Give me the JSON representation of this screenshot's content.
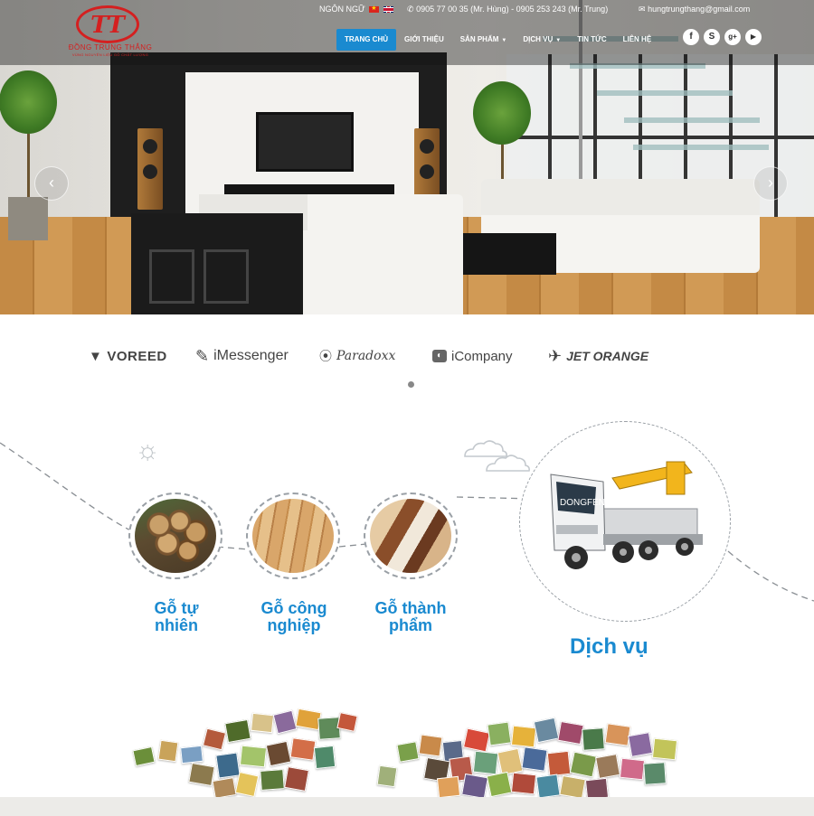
{
  "header": {
    "logo_text": "ĐỒNG TRUNG THẮNG",
    "logo_sub": "VÙNG NGUYÊN LIỆU GỖ CHẤT LƯỢNG",
    "language_label": "NGÔN NGỮ",
    "phone_icon": "phone-icon",
    "phone": "0905 77 00 35 (Mr. Hùng) - 0905 253 243 (Mr. Trung)",
    "email_icon": "envelope-icon",
    "email": "hungtrungthang@gmail.com"
  },
  "nav": {
    "items": [
      {
        "label": "TRANG CHỦ",
        "active": true
      },
      {
        "label": "GIỚI THIỆU",
        "active": false
      },
      {
        "label": "SẢN PHẨM",
        "active": false,
        "dropdown": true
      },
      {
        "label": "DỊCH VỤ",
        "active": false,
        "dropdown": true
      },
      {
        "label": "TIN TỨC",
        "active": false
      },
      {
        "label": "LIÊN HỆ",
        "active": false
      }
    ]
  },
  "social": [
    {
      "name": "facebook-icon",
      "glyph": "f"
    },
    {
      "name": "skype-icon",
      "glyph": "S"
    },
    {
      "name": "google-plus-icon",
      "glyph": "g+"
    },
    {
      "name": "youtube-icon",
      "glyph": "▶"
    }
  ],
  "slider": {
    "prev_glyph": "‹",
    "next_glyph": "›"
  },
  "partners": [
    {
      "name": "VOREED",
      "icon": "voreed-logo"
    },
    {
      "name": "iMessenger",
      "icon": "imessenger-logo"
    },
    {
      "name": "Paradoxx",
      "icon": "paradoxx-logo"
    },
    {
      "name": "iCompany",
      "icon": "icompany-logo"
    },
    {
      "name": "JET ORANGE",
      "icon": "jet-orange-logo"
    }
  ],
  "services": [
    {
      "line1": "Gỗ tự",
      "line2": "nhiên"
    },
    {
      "line1": "Gỗ công",
      "line2": "nghiệp"
    },
    {
      "line1": "Gỗ thành",
      "line2": "phẩm"
    },
    {
      "line1": "Dịch vụ",
      "line2": ""
    }
  ],
  "colors": {
    "accent": "#1a8ad0",
    "brand_red": "#d42020",
    "label_blue": "#1a8ad0"
  }
}
